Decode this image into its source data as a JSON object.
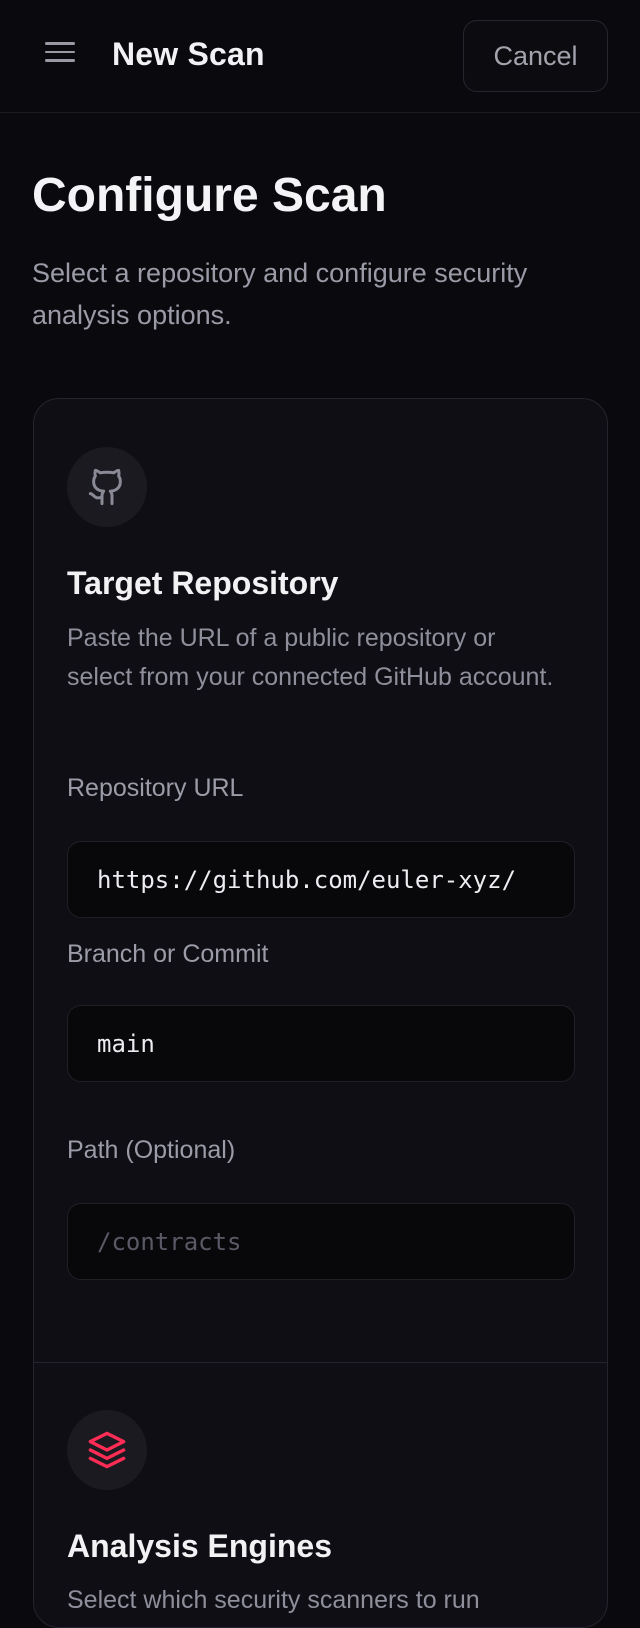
{
  "header": {
    "title": "New Scan",
    "cancel_label": "Cancel",
    "menu_icon": "menu-icon"
  },
  "page": {
    "title": "Configure Scan",
    "subtitle": "Select a repository and configure security analysis options."
  },
  "target_repository": {
    "icon": "github-icon",
    "title": "Target Repository",
    "description": "Paste the URL of a public repository or select from your connected GitHub account.",
    "fields": {
      "repo_url": {
        "label": "Repository URL",
        "value": "https://github.com/euler-xyz/"
      },
      "branch": {
        "label": "Branch or Commit",
        "value": "main"
      },
      "path": {
        "label": "Path (Optional)",
        "placeholder": "/contracts",
        "value": ""
      }
    }
  },
  "analysis_engines": {
    "icon": "layers-icon",
    "icon_color": "#ff2d55",
    "title": "Analysis Engines",
    "description": "Select which security scanners to run"
  }
}
